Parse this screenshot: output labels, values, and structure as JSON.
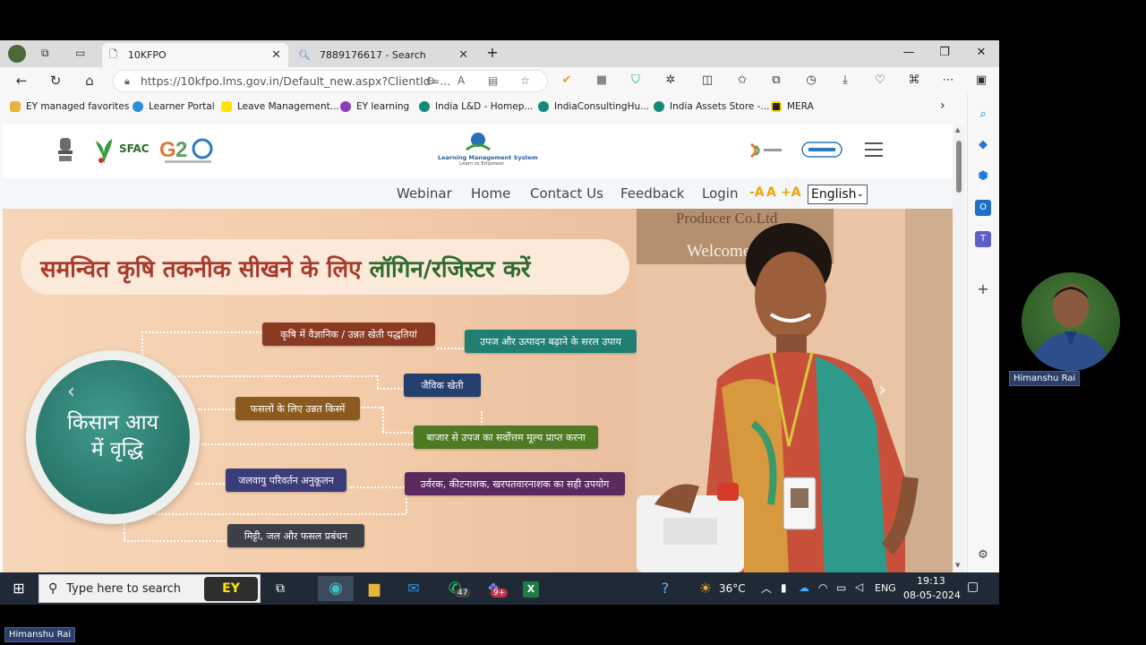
{
  "browser": {
    "tabs": [
      {
        "title": "10KFPO",
        "active": true
      },
      {
        "title": "7889176617 - Search",
        "active": false
      }
    ],
    "url": "https://10kfpo.lms.gov.in/Default_new.aspx?ClientId=...",
    "favorites": [
      {
        "label": "EY managed favorites",
        "icon": "folder-icon",
        "color": "#e8b53c"
      },
      {
        "label": "Learner Portal",
        "icon": "edge-icon",
        "color": "#2b8fd6"
      },
      {
        "label": "Leave Management...",
        "icon": "ey-icon",
        "color": "#ffe600"
      },
      {
        "label": "EY learning",
        "icon": "learning-icon",
        "color": "#8a3fb8"
      },
      {
        "label": "India L&D - Homep...",
        "icon": "sharepoint-icon",
        "color": "#128a7a"
      },
      {
        "label": "IndiaConsultingHu...",
        "icon": "sharepoint-icon",
        "color": "#128a7a"
      },
      {
        "label": "India Assets Store -...",
        "icon": "sharepoint-icon",
        "color": "#128a7a"
      },
      {
        "label": "MERA",
        "icon": "mera-icon",
        "color": "#222222"
      }
    ]
  },
  "site": {
    "logos": {
      "sfac": "SFAC",
      "lms_title": "Learning Management System",
      "lms_tagline": "Learn to Empower"
    },
    "nav": {
      "webinar": "Webinar",
      "home": "Home",
      "contact": "Contact Us",
      "feedback": "Feedback",
      "login": "Login",
      "font_minus": "-A",
      "font_normal": "A",
      "font_plus": "+A",
      "language": "English"
    },
    "hero": {
      "headline_part1": "समन्वित कृषि तकनीक सीखने के लिए ",
      "headline_part2": "लॉगिन/रजिस्टर करें",
      "center_title_1": "किसान आय",
      "center_title_2": "में वृद्धि",
      "chips": {
        "c1": "कृषि में वैज्ञानिक / उन्नत खेती पद्धतियां",
        "c2": "उपज और उत्पादन बढ़ाने के सरल उपाय",
        "c3": "जैविक खेती",
        "c4": "फसलों के लिए उन्नत किस्में",
        "c5": "बाजार से उपज का सर्वोत्तम मूल्य प्राप्त करना",
        "c6": "जलवायु परिवर्तन अनुकूलन",
        "c7": "उर्वरक, कीटनाशक, खरपतवारनाशक का सही उपयोग",
        "c8": "मिट्टी, जल और फसल प्रबंधन"
      },
      "sign_line1": "Producer Co.Ltd",
      "sign_line2": "Welcome"
    }
  },
  "taskbar": {
    "search_placeholder": "Type here to search",
    "whatsapp_badge": "47",
    "teams_badge": "9+",
    "weather": "36°C",
    "lang": "ENG",
    "time": "19:13",
    "date": "08-05-2024"
  },
  "participant": {
    "name_cam": "Himanshu Rai",
    "name_bottom": "Himanshu Rai"
  }
}
